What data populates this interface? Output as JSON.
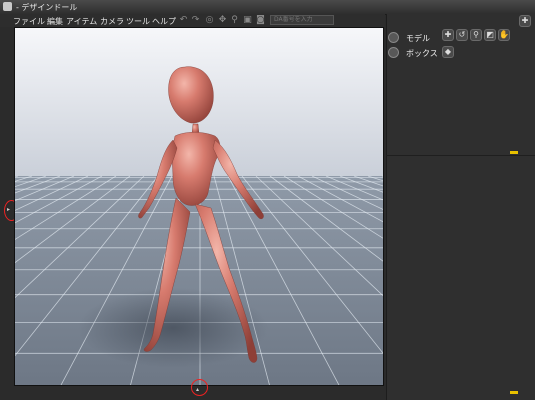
{
  "window": {
    "title": "- デザインドール"
  },
  "menu": {
    "items": [
      "ファイル",
      "編集",
      "アイテム",
      "カメラ",
      "ツール",
      "ヘルプ"
    ]
  },
  "toolbar": {
    "icons": [
      "undo-icon",
      "redo-icon",
      "rotate-icon",
      "move-icon",
      "zoom-icon",
      "camera-icon",
      "screenshot-icon"
    ],
    "search_placeholder": "DA番号を入力"
  },
  "right_panel": {
    "rows": [
      {
        "label": "モデル",
        "icon": "eye-icon"
      },
      {
        "label": "ボックス",
        "icon": "eye-icon"
      }
    ],
    "tools": [
      "add-icon",
      "rotate-model-icon",
      "zoom-model-icon",
      "select-icon",
      "hand-icon",
      "cube-icon"
    ]
  },
  "colors": {
    "accent_yellow": "#e8c100",
    "highlight_red": "#e22222",
    "model_skin": "#c96a60"
  }
}
